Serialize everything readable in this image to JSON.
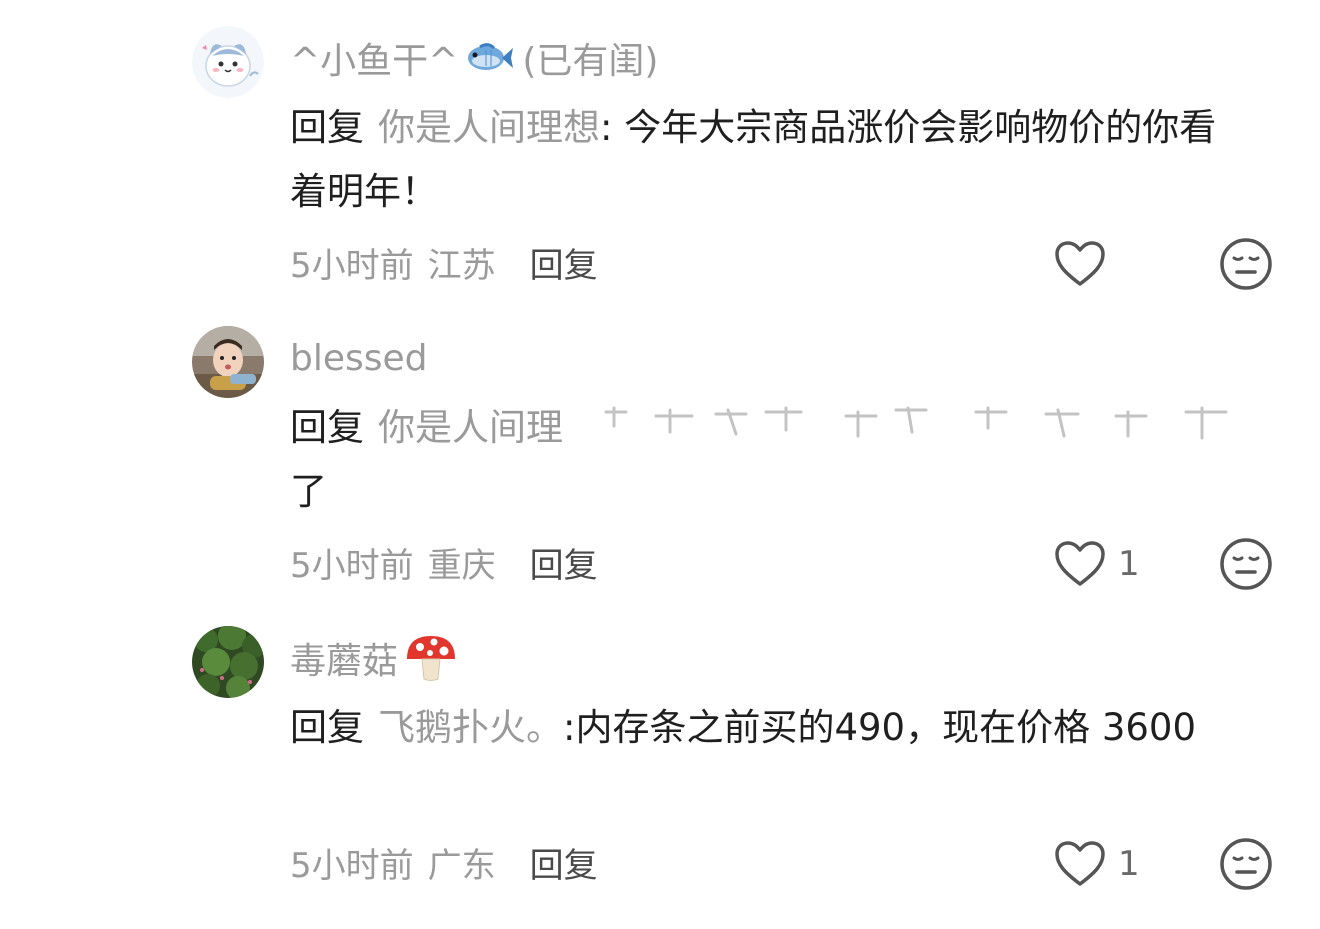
{
  "comments": [
    {
      "username": "^小鱼干^",
      "username_emoji": "fish-emoji",
      "username_suffix": "(已有闺)",
      "reply_prefix": "回复",
      "reply_target": "你是人间理想",
      "reply_colon": ":",
      "reply_text": " 今年大宗商品涨价会影响物价的你看着明年！",
      "time": "5小时前",
      "location": "江苏",
      "reply_label": "回复",
      "likes": "",
      "avatar": "cartoon-cat-avatar"
    },
    {
      "username": "blessed",
      "username_emoji": "",
      "username_suffix": "",
      "reply_prefix": "回复",
      "reply_target": "你是人间理",
      "reply_colon": "",
      "reply_text": "了",
      "time": "5小时前",
      "location": "重庆",
      "reply_label": "回复",
      "likes": "1",
      "avatar": "child-photo-avatar"
    },
    {
      "username": "毒蘑菇",
      "username_emoji": "mushroom-emoji",
      "username_suffix": "",
      "reply_prefix": "回复",
      "reply_target": "飞鹅扑火。",
      "reply_colon": ":",
      "reply_text": "内存条之前买的490，现在价格 3600",
      "time": "5小时前",
      "location": "广东",
      "reply_label": "回复",
      "likes": "1",
      "avatar": "green-plants-avatar"
    }
  ],
  "colors": {
    "secondary_text": "#9a9a9a",
    "primary_text": "#1f1f1f",
    "icon_stroke": "#555555"
  }
}
